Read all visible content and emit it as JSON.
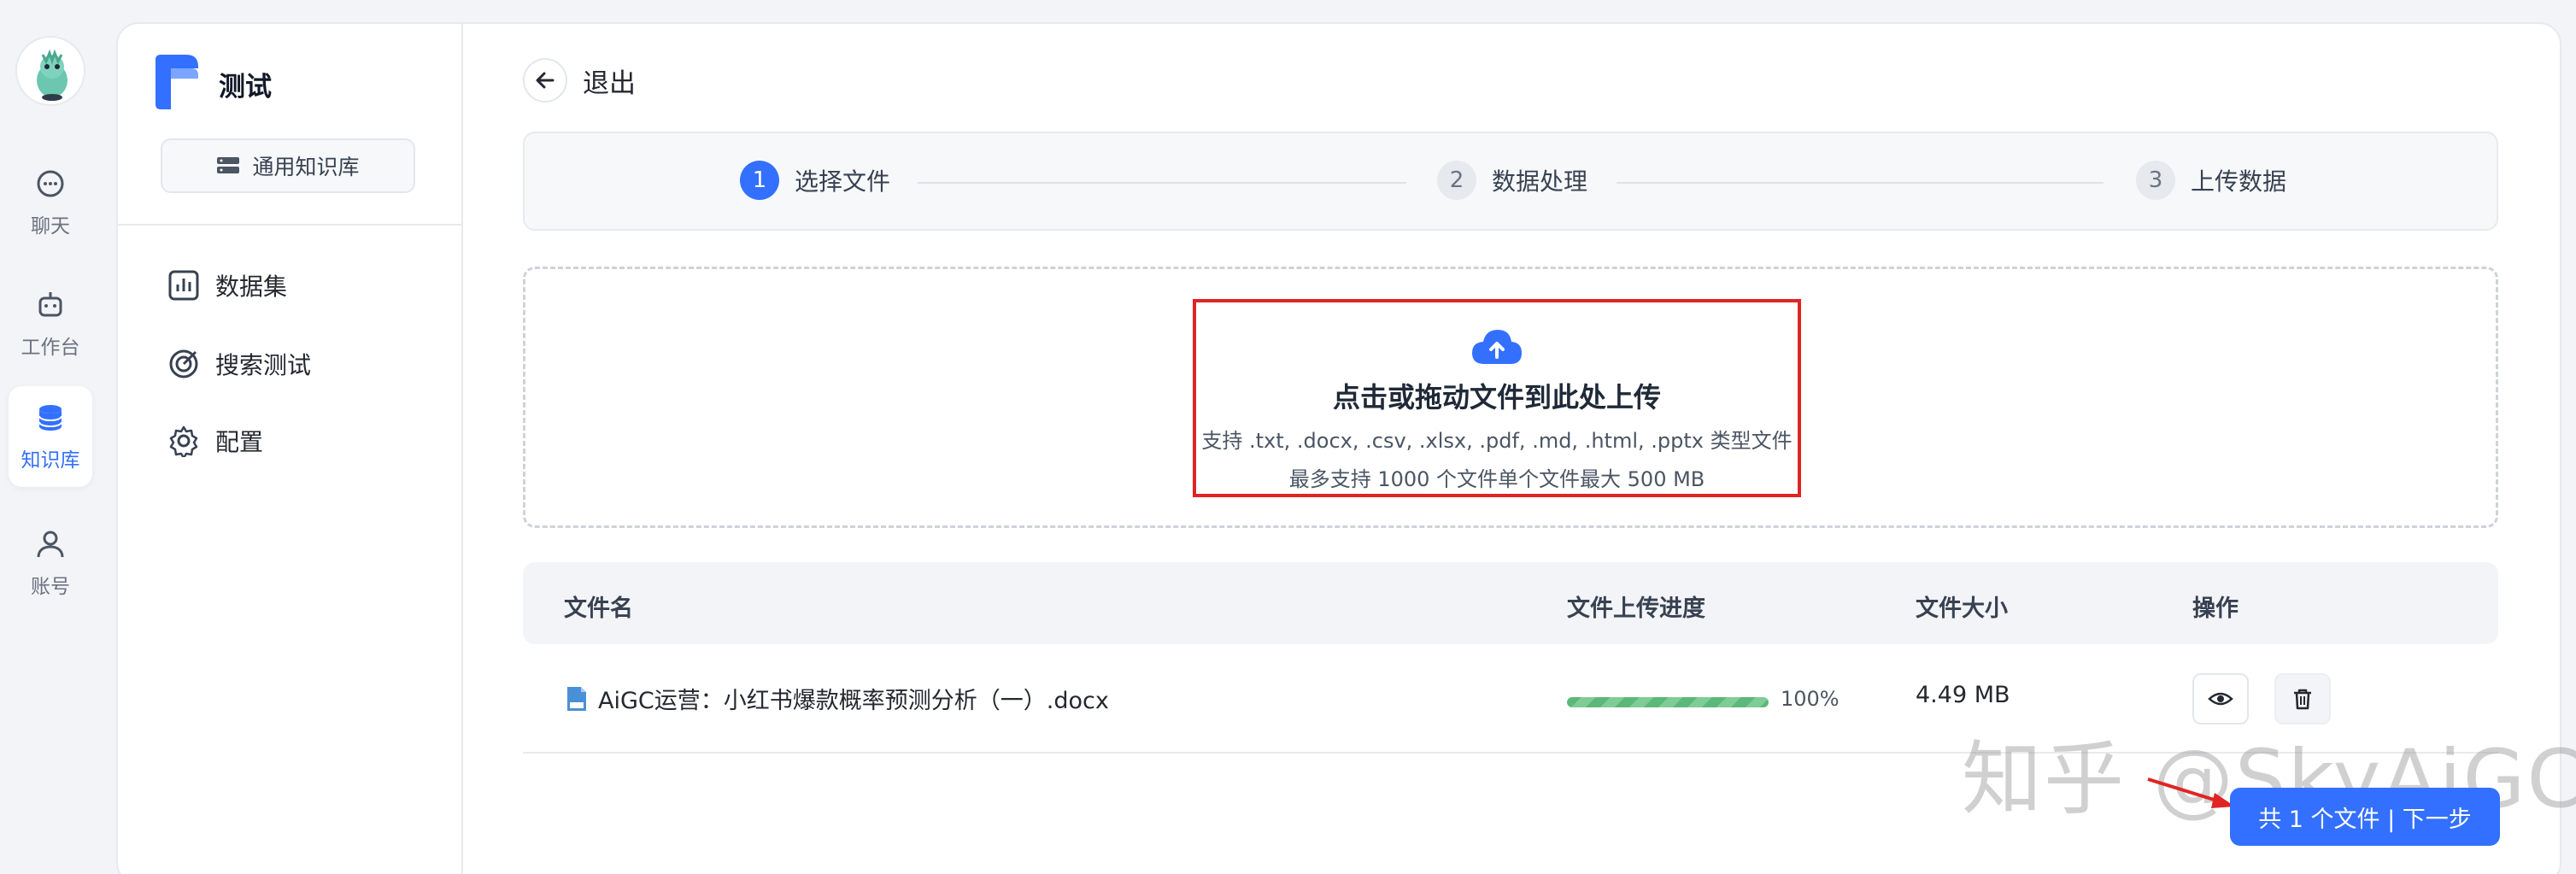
{
  "rail": {
    "items": [
      {
        "label": "聊天",
        "icon": "chat-icon"
      },
      {
        "label": "工作台",
        "icon": "robot-icon"
      },
      {
        "label": "知识库",
        "icon": "database-icon"
      },
      {
        "label": "账号",
        "icon": "user-icon"
      }
    ]
  },
  "side": {
    "kb_name": "测试",
    "kb_type": "通用知识库",
    "nav": [
      {
        "label": "数据集",
        "icon": "chart-icon"
      },
      {
        "label": "搜索测试",
        "icon": "target-icon"
      },
      {
        "label": "配置",
        "icon": "gear-icon"
      }
    ]
  },
  "header": {
    "back_label": "退出"
  },
  "steps": [
    {
      "num": "1",
      "label": "选择文件"
    },
    {
      "num": "2",
      "label": "数据处理"
    },
    {
      "num": "3",
      "label": "上传数据"
    }
  ],
  "dropzone": {
    "title": "点击或拖动文件到此处上传",
    "line1": "支持 .txt, .docx, .csv, .xlsx, .pdf, .md, .html, .pptx 类型文件",
    "line2": "最多支持 1000 个文件单个文件最大 500 MB"
  },
  "table": {
    "headers": [
      "文件名",
      "文件上传进度",
      "文件大小",
      "操作"
    ],
    "rows": [
      {
        "name": "AiGC运营：小红书爆款概率预测分析（一）.docx",
        "progress": 100,
        "progress_label": "100%",
        "size": "4.49 MB"
      }
    ]
  },
  "footer": {
    "next_label": "共 1 个文件 | 下一步"
  },
  "watermark": "知乎 @SkyAiGC",
  "colors": {
    "accent": "#3370ff",
    "highlight": "#e02424",
    "progress": "#5bb878"
  }
}
